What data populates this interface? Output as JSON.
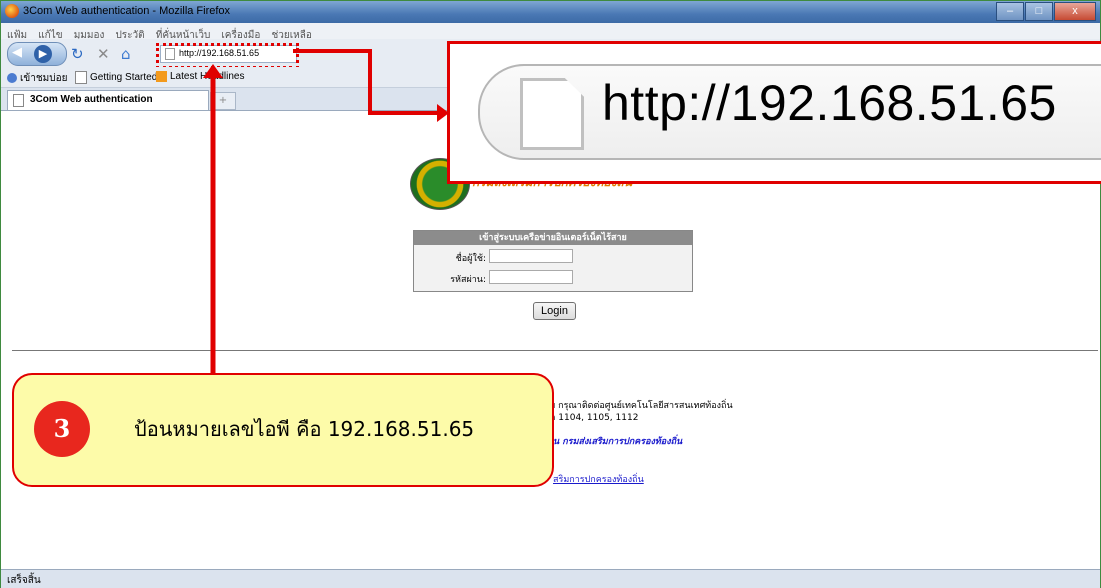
{
  "window": {
    "title": "3Com Web authentication - Mozilla Firefox",
    "buttons": [
      "–",
      "□",
      "x"
    ]
  },
  "menu": [
    "แฟ้ม",
    "แก้ไข",
    "มุมมอง",
    "ประวัติ",
    "ที่คั่นหน้าเว็บ",
    "เครื่องมือ",
    "ช่วยเหลือ"
  ],
  "nav": {
    "reload_icon": "reload-icon",
    "stop_icon": "stop-icon",
    "home_icon": "home-icon",
    "url": "http://192.168.51.65"
  },
  "bookmarks": [
    "เข้าชมบ่อย",
    "Getting Started",
    "Latest Headlines"
  ],
  "tabs": {
    "active": "3Com Web authentication",
    "new_tab": "+"
  },
  "zoom": {
    "url": "http://192.168.51.65"
  },
  "page": {
    "org_name": "กรมส่งเสริมการปกครองท้องถิ่น",
    "login_header": "เข้าสู่ระบบเครือข่ายอินเตอร์เน็ตไร้สาย",
    "username_label": "ชื่อผู้ใช้:",
    "password_label": "รหัสผ่าน:",
    "login_button": "Login",
    "info_line1": "ย กรุณาติดต่อศูนย์เทคโนโลยีสารสนเทศท้องถิ่น",
    "info_line2": "อ 1104, 1105, 1112",
    "info_line3": "น กรมส่งเสริมการปกครองท้องถิ่น",
    "info_line4": "สริมการปกครองท้องถิ่น"
  },
  "callout": {
    "number": "3",
    "text": "ป้อนหมายเลขไอพี คือ 192.168.51.65"
  },
  "status": "เสร็จสิ้น",
  "colors": {
    "annotation_red": "#e00000",
    "callout_yellow": "#fdfba9"
  }
}
